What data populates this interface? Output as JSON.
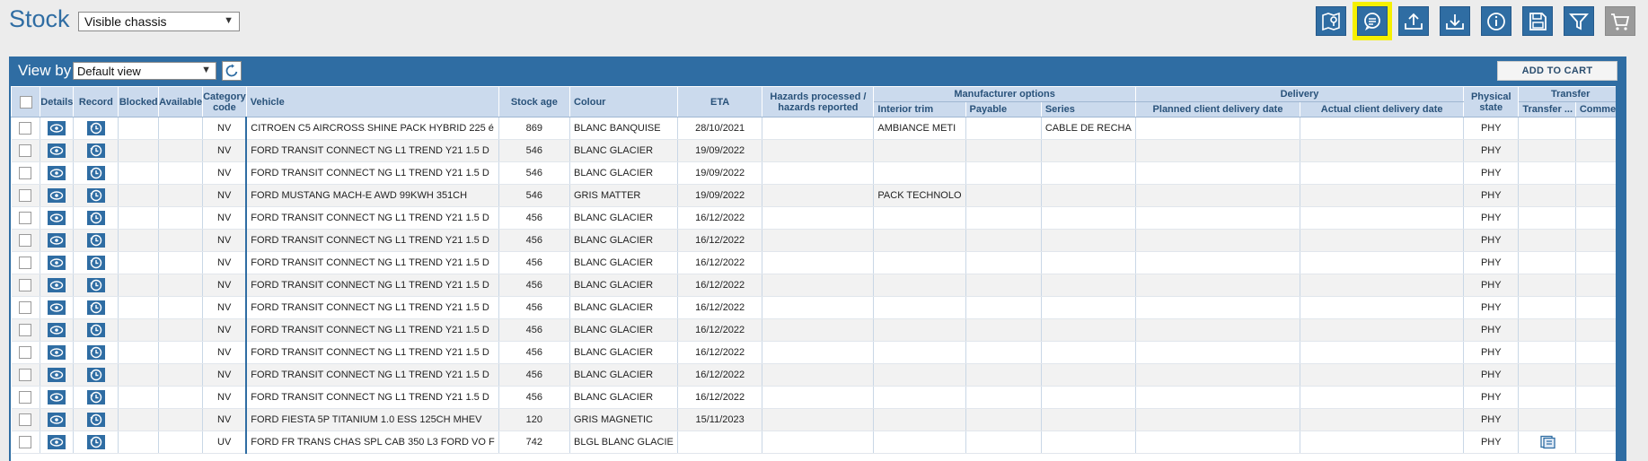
{
  "header": {
    "title": "Stock",
    "filter_select_value": "Visible chassis"
  },
  "toolbar": [
    {
      "name": "map-pin-icon-button",
      "icon": "map-pin-icon",
      "highlight": false,
      "disabled": false
    },
    {
      "name": "comments-icon-button",
      "icon": "comments-icon",
      "highlight": true,
      "disabled": false
    },
    {
      "name": "upload-icon-button",
      "icon": "upload-tray-icon",
      "highlight": false,
      "disabled": false
    },
    {
      "name": "download-icon-button",
      "icon": "download-tray-icon",
      "highlight": false,
      "disabled": false
    },
    {
      "name": "info-icon-button",
      "icon": "info-icon",
      "highlight": false,
      "disabled": false
    },
    {
      "name": "save-icon-button",
      "icon": "floppy-disk-icon",
      "highlight": false,
      "disabled": false
    },
    {
      "name": "filter-icon-button",
      "icon": "funnel-icon",
      "highlight": false,
      "disabled": false
    },
    {
      "name": "cart-icon-button",
      "icon": "cart-icon",
      "highlight": false,
      "disabled": true
    }
  ],
  "panel": {
    "viewby_label": "View by",
    "viewby_value": "Default view",
    "add_to_cart_label": "ADD TO CART"
  },
  "columns": {
    "groups": {
      "manufacturer_options": "Manufacturer options",
      "delivery": "Delivery",
      "transfer": "Transfer"
    },
    "details": "Details",
    "record": "Record",
    "blocked": "Blocked",
    "available": "Available",
    "category_code": "Category code",
    "vehicle": "Vehicle",
    "stock_age": "Stock age",
    "colour": "Colour",
    "eta": "ETA",
    "hazards": "Hazards processed / hazards reported",
    "interior_trim": "Interior trim",
    "payable": "Payable",
    "series": "Series",
    "planned_delivery": "Planned client delivery date",
    "actual_delivery": "Actual client delivery date",
    "physical_state": "Physical state",
    "transfer_sub": "Transfer ...",
    "comments": "Commen"
  },
  "rows": [
    {
      "category": "NV",
      "vehicle": "CITROEN C5 AIRCROSS SHINE PACK HYBRID 225 é",
      "stock_age": "869",
      "colour": "BLANC BANQUISE",
      "eta": "28/10/2021",
      "interior_trim": "AMBIANCE METI",
      "series": "CABLE DE RECHA",
      "physical_state": "PHY",
      "transfer_doc": false
    },
    {
      "category": "NV",
      "vehicle": "FORD TRANSIT CONNECT NG L1 TREND Y21 1.5 D",
      "stock_age": "546",
      "colour": "BLANC GLACIER",
      "eta": "19/09/2022",
      "interior_trim": "",
      "series": "",
      "physical_state": "PHY",
      "transfer_doc": false
    },
    {
      "category": "NV",
      "vehicle": "FORD TRANSIT CONNECT NG L1 TREND Y21 1.5 D",
      "stock_age": "546",
      "colour": "BLANC GLACIER",
      "eta": "19/09/2022",
      "interior_trim": "",
      "series": "",
      "physical_state": "PHY",
      "transfer_doc": false
    },
    {
      "category": "NV",
      "vehicle": "FORD MUSTANG MACH-E AWD 99KWH 351CH",
      "stock_age": "546",
      "colour": "GRIS MATTER",
      "eta": "19/09/2022",
      "interior_trim": "PACK TECHNOLO",
      "series": "",
      "physical_state": "PHY",
      "transfer_doc": false
    },
    {
      "category": "NV",
      "vehicle": "FORD TRANSIT CONNECT NG L1 TREND Y21 1.5 D",
      "stock_age": "456",
      "colour": "BLANC GLACIER",
      "eta": "16/12/2022",
      "interior_trim": "",
      "series": "",
      "physical_state": "PHY",
      "transfer_doc": false
    },
    {
      "category": "NV",
      "vehicle": "FORD TRANSIT CONNECT NG L1 TREND Y21 1.5 D",
      "stock_age": "456",
      "colour": "BLANC GLACIER",
      "eta": "16/12/2022",
      "interior_trim": "",
      "series": "",
      "physical_state": "PHY",
      "transfer_doc": false
    },
    {
      "category": "NV",
      "vehicle": "FORD TRANSIT CONNECT NG L1 TREND Y21 1.5 D",
      "stock_age": "456",
      "colour": "BLANC GLACIER",
      "eta": "16/12/2022",
      "interior_trim": "",
      "series": "",
      "physical_state": "PHY",
      "transfer_doc": false
    },
    {
      "category": "NV",
      "vehicle": "FORD TRANSIT CONNECT NG L1 TREND Y21 1.5 D",
      "stock_age": "456",
      "colour": "BLANC GLACIER",
      "eta": "16/12/2022",
      "interior_trim": "",
      "series": "",
      "physical_state": "PHY",
      "transfer_doc": false
    },
    {
      "category": "NV",
      "vehicle": "FORD TRANSIT CONNECT NG L1 TREND Y21 1.5 D",
      "stock_age": "456",
      "colour": "BLANC GLACIER",
      "eta": "16/12/2022",
      "interior_trim": "",
      "series": "",
      "physical_state": "PHY",
      "transfer_doc": false
    },
    {
      "category": "NV",
      "vehicle": "FORD TRANSIT CONNECT NG L1 TREND Y21 1.5 D",
      "stock_age": "456",
      "colour": "BLANC GLACIER",
      "eta": "16/12/2022",
      "interior_trim": "",
      "series": "",
      "physical_state": "PHY",
      "transfer_doc": false
    },
    {
      "category": "NV",
      "vehicle": "FORD TRANSIT CONNECT NG L1 TREND Y21 1.5 D",
      "stock_age": "456",
      "colour": "BLANC GLACIER",
      "eta": "16/12/2022",
      "interior_trim": "",
      "series": "",
      "physical_state": "PHY",
      "transfer_doc": false
    },
    {
      "category": "NV",
      "vehicle": "FORD TRANSIT CONNECT NG L1 TREND Y21 1.5 D",
      "stock_age": "456",
      "colour": "BLANC GLACIER",
      "eta": "16/12/2022",
      "interior_trim": "",
      "series": "",
      "physical_state": "PHY",
      "transfer_doc": false
    },
    {
      "category": "NV",
      "vehicle": "FORD TRANSIT CONNECT NG L1 TREND Y21 1.5 D",
      "stock_age": "456",
      "colour": "BLANC GLACIER",
      "eta": "16/12/2022",
      "interior_trim": "",
      "series": "",
      "physical_state": "PHY",
      "transfer_doc": false
    },
    {
      "category": "NV",
      "vehicle": "FORD FIESTA 5P TITANIUM 1.0 ESS 125CH MHEV",
      "stock_age": "120",
      "colour": "GRIS MAGNETIC",
      "eta": "15/11/2023",
      "interior_trim": "",
      "series": "",
      "physical_state": "PHY",
      "transfer_doc": false
    },
    {
      "category": "UV",
      "vehicle": "FORD FR TRANS CHAS SPL CAB 350 L3 FORD VO F",
      "stock_age": "742",
      "colour": "BLGL BLANC GLACIE",
      "eta": "",
      "interior_trim": "",
      "series": "",
      "physical_state": "PHY",
      "transfer_doc": true
    }
  ],
  "colors": {
    "brand_blue": "#2f6da3",
    "header_cell": "#cbdaed",
    "highlight": "#f6f000"
  }
}
